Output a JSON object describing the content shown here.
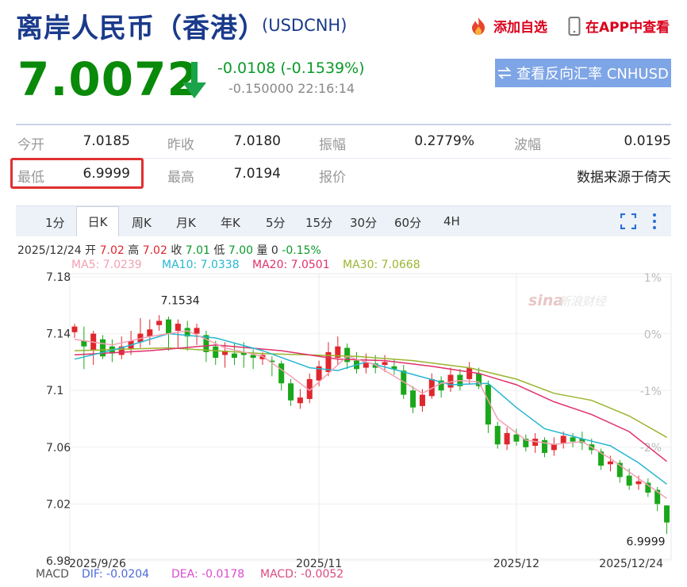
{
  "header": {
    "title": "离岸人民币（香港）",
    "code": "(USDCNH)",
    "add_watch": "添加自选",
    "view_app": "在APP中查看",
    "price": "7.0072",
    "change": "-0.0108 (-0.1539%)",
    "sub_line": "-0.150000 22:16:14",
    "reverse_btn": "查看反向汇率 CNHUSD"
  },
  "stats": {
    "open_label": "今开",
    "open_value": "7.0185",
    "prev_close_label": "昨收",
    "prev_close_value": "7.0180",
    "amplitude_label": "振幅",
    "amplitude_value": "0.2779%",
    "wave_label": "波幅",
    "wave_value": "0.0195",
    "low_label": "最低",
    "low_value": "6.9999",
    "high_label": "最高",
    "high_value": "7.0194",
    "quote_label": "报价",
    "source_text": "数据来源于倚天"
  },
  "tabs": [
    "1分",
    "日K",
    "周K",
    "月K",
    "年K",
    "5分",
    "15分",
    "30分",
    "60分",
    "4H"
  ],
  "active_tab": "日K",
  "info_line": {
    "date": "2025/12/24",
    "open_label": "开",
    "open": "7.02",
    "high_label": "高",
    "high": "7.02",
    "close_label": "收",
    "close": "7.01",
    "low_label": "低",
    "low": "7.00",
    "vol_label": "量",
    "vol": "0",
    "pct": "-0.15%"
  },
  "ma_legend": {
    "ma5": "MA5: 7.0239",
    "ma10": "MA10: 7.0338",
    "ma20": "MA20: 7.0501",
    "ma30": "MA30: 7.0668"
  },
  "colors": {
    "up": "#e0262d",
    "down": "#1aa71a",
    "ma5": "#f3a0b4",
    "ma10": "#27b7d0",
    "ma20": "#e0306a",
    "ma30": "#99b530"
  },
  "macd": {
    "label": "MACD",
    "dif": "DIF: -0.0204",
    "dea": "DEA: -0.0178",
    "macd": "MACD: -0.0052"
  },
  "watermark": "新浪财经",
  "chart_data": {
    "type": "candlestick",
    "y_ticks": [
      "7.18",
      "7.14",
      "7.1",
      "7.06",
      "7.02",
      "6.98"
    ],
    "y_tick_values": [
      7.18,
      7.14,
      7.1,
      7.06,
      7.02,
      6.98
    ],
    "pct_ticks": [
      "1%",
      "0%",
      "-1%",
      "-2%"
    ],
    "pct_values": [
      1,
      0,
      -1,
      -2
    ],
    "x_labels": [
      "2025/9/26",
      "2025/11",
      "2025/12",
      "2025/12/24"
    ],
    "x_label_index": [
      0,
      26,
      47,
      62
    ],
    "ylim": [
      6.98,
      7.18
    ],
    "annotations": [
      {
        "text": "7.1534",
        "index": 9,
        "value": 7.1534
      },
      {
        "text": "6.9999",
        "index": 63,
        "value": 6.9999
      }
    ],
    "candles": [
      [
        7.141,
        7.145,
        7.147,
        7.137
      ],
      [
        7.135,
        7.131,
        7.145,
        7.115
      ],
      [
        7.128,
        7.14,
        7.142,
        7.118
      ],
      [
        7.136,
        7.124,
        7.139,
        7.122
      ],
      [
        7.131,
        7.126,
        7.136,
        7.12
      ],
      [
        7.125,
        7.131,
        7.138,
        7.122
      ],
      [
        7.129,
        7.135,
        7.142,
        7.125
      ],
      [
        7.134,
        7.14,
        7.151,
        7.13
      ],
      [
        7.138,
        7.143,
        7.15,
        7.132
      ],
      [
        7.146,
        7.149,
        7.153,
        7.142
      ],
      [
        7.15,
        7.14,
        7.152,
        7.128
      ],
      [
        7.142,
        7.147,
        7.15,
        7.13
      ],
      [
        7.144,
        7.138,
        7.149,
        7.128
      ],
      [
        7.14,
        7.144,
        7.147,
        7.132
      ],
      [
        7.139,
        7.127,
        7.142,
        7.12
      ],
      [
        7.131,
        7.123,
        7.135,
        7.118
      ],
      [
        7.125,
        7.128,
        7.134,
        7.116
      ],
      [
        7.126,
        7.123,
        7.133,
        7.118
      ],
      [
        7.127,
        7.125,
        7.134,
        7.116
      ],
      [
        7.125,
        7.123,
        7.129,
        7.115
      ],
      [
        7.122,
        7.125,
        7.127,
        7.118
      ],
      [
        7.121,
        7.12,
        7.124,
        7.11
      ],
      [
        7.119,
        7.105,
        7.121,
        7.1
      ],
      [
        7.105,
        7.093,
        7.108,
        7.089
      ],
      [
        7.091,
        7.095,
        7.101,
        7.087
      ],
      [
        7.094,
        7.108,
        7.112,
        7.091
      ],
      [
        7.107,
        7.117,
        7.121,
        7.103
      ],
      [
        7.113,
        7.127,
        7.134,
        7.11
      ],
      [
        7.123,
        7.131,
        7.138,
        7.118
      ],
      [
        7.13,
        7.12,
        7.133,
        7.115
      ],
      [
        7.121,
        7.115,
        7.127,
        7.112
      ],
      [
        7.116,
        7.12,
        7.126,
        7.112
      ],
      [
        7.119,
        7.116,
        7.125,
        7.112
      ],
      [
        7.118,
        7.12,
        7.125,
        7.113
      ],
      [
        7.117,
        7.115,
        7.122,
        7.111
      ],
      [
        7.114,
        7.097,
        7.118,
        7.094
      ],
      [
        7.1,
        7.088,
        7.103,
        7.084
      ],
      [
        7.089,
        7.097,
        7.101,
        7.085
      ],
      [
        7.096,
        7.108,
        7.112,
        7.094
      ],
      [
        7.107,
        7.1,
        7.11,
        7.095
      ],
      [
        7.102,
        7.111,
        7.116,
        7.099
      ],
      [
        7.111,
        7.103,
        7.115,
        7.1
      ],
      [
        7.108,
        7.116,
        7.12,
        7.104
      ],
      [
        7.112,
        7.103,
        7.116,
        7.101
      ],
      [
        7.104,
        7.076,
        7.107,
        7.07
      ],
      [
        7.075,
        7.062,
        7.078,
        7.059
      ],
      [
        7.062,
        7.07,
        7.074,
        7.058
      ],
      [
        7.069,
        7.064,
        7.073,
        7.061
      ],
      [
        7.066,
        7.06,
        7.069,
        7.057
      ],
      [
        7.061,
        7.066,
        7.07,
        7.056
      ],
      [
        7.065,
        7.056,
        7.067,
        7.053
      ],
      [
        7.058,
        7.062,
        7.067,
        7.054
      ],
      [
        7.063,
        7.068,
        7.071,
        7.059
      ],
      [
        7.067,
        7.064,
        7.07,
        7.06
      ],
      [
        7.066,
        7.063,
        7.071,
        7.058
      ],
      [
        7.062,
        7.058,
        7.066,
        7.055
      ],
      [
        7.057,
        7.047,
        7.059,
        7.044
      ],
      [
        7.048,
        7.05,
        7.054,
        7.043
      ],
      [
        7.049,
        7.039,
        7.051,
        7.035
      ],
      [
        7.04,
        7.033,
        7.045,
        7.03
      ],
      [
        7.034,
        7.036,
        7.04,
        7.03
      ],
      [
        7.035,
        7.028,
        7.038,
        7.025
      ],
      [
        7.03,
        7.02,
        7.032,
        7.015
      ],
      [
        7.019,
        7.007,
        7.019,
        6.999
      ]
    ],
    "ma5": [
      [
        0,
        7.136
      ],
      [
        4,
        7.132
      ],
      [
        8,
        7.138
      ],
      [
        12,
        7.142
      ],
      [
        16,
        7.13
      ],
      [
        20,
        7.124
      ],
      [
        23,
        7.11
      ],
      [
        25,
        7.1
      ],
      [
        27,
        7.112
      ],
      [
        29,
        7.124
      ],
      [
        32,
        7.118
      ],
      [
        35,
        7.106
      ],
      [
        37,
        7.098
      ],
      [
        39,
        7.105
      ],
      [
        41,
        7.107
      ],
      [
        43,
        7.106
      ],
      [
        45,
        7.08
      ],
      [
        48,
        7.065
      ],
      [
        51,
        7.062
      ],
      [
        54,
        7.064
      ],
      [
        57,
        7.052
      ],
      [
        60,
        7.038
      ],
      [
        63,
        7.024
      ]
    ],
    "ma10": [
      [
        0,
        7.122
      ],
      [
        5,
        7.13
      ],
      [
        10,
        7.14
      ],
      [
        15,
        7.137
      ],
      [
        20,
        7.128
      ],
      [
        25,
        7.116
      ],
      [
        28,
        7.114
      ],
      [
        31,
        7.12
      ],
      [
        35,
        7.113
      ],
      [
        40,
        7.104
      ],
      [
        44,
        7.105
      ],
      [
        47,
        7.088
      ],
      [
        50,
        7.073
      ],
      [
        54,
        7.066
      ],
      [
        57,
        7.061
      ],
      [
        60,
        7.049
      ],
      [
        63,
        7.034
      ]
    ],
    "ma20": [
      [
        0,
        7.125
      ],
      [
        8,
        7.128
      ],
      [
        15,
        7.132
      ],
      [
        22,
        7.128
      ],
      [
        28,
        7.122
      ],
      [
        33,
        7.121
      ],
      [
        38,
        7.117
      ],
      [
        43,
        7.112
      ],
      [
        47,
        7.104
      ],
      [
        51,
        7.092
      ],
      [
        55,
        7.083
      ],
      [
        59,
        7.071
      ],
      [
        63,
        7.05
      ]
    ],
    "ma30": [
      [
        0,
        7.128
      ],
      [
        10,
        7.13
      ],
      [
        20,
        7.126
      ],
      [
        30,
        7.124
      ],
      [
        36,
        7.121
      ],
      [
        42,
        7.116
      ],
      [
        47,
        7.108
      ],
      [
        51,
        7.098
      ],
      [
        55,
        7.093
      ],
      [
        59,
        7.082
      ],
      [
        63,
        7.067
      ]
    ]
  }
}
